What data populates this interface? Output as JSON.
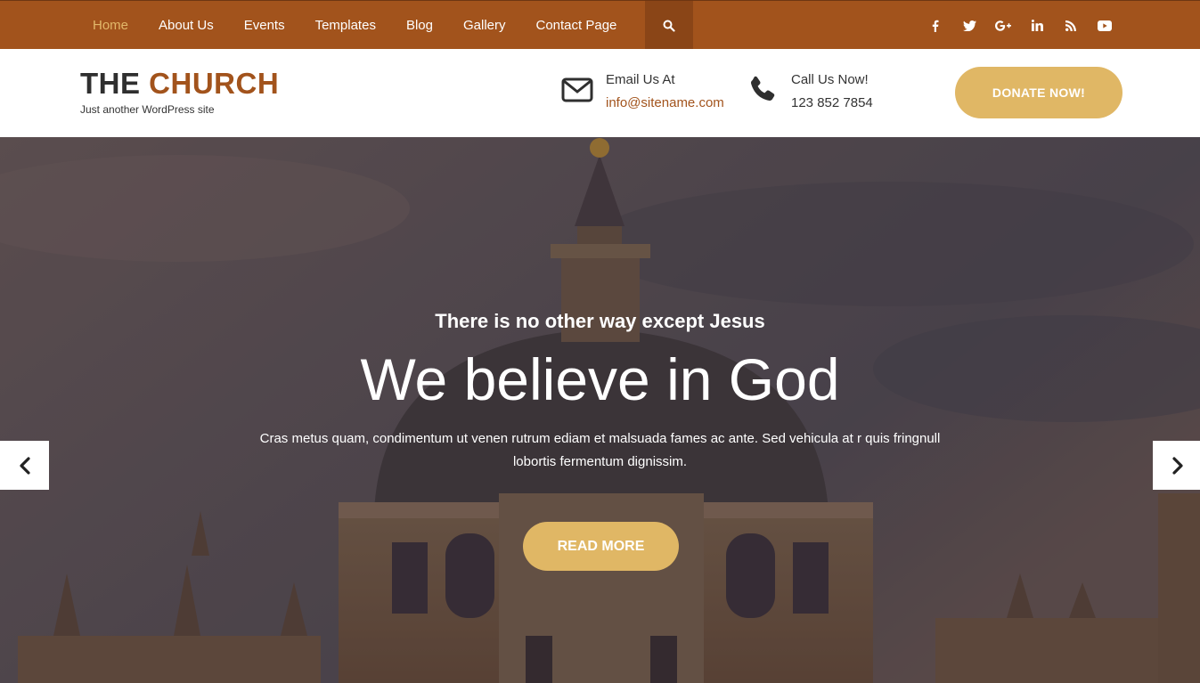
{
  "nav": {
    "items": [
      {
        "label": "Home",
        "active": true
      },
      {
        "label": "About Us"
      },
      {
        "label": "Events"
      },
      {
        "label": "Templates"
      },
      {
        "label": "Blog"
      },
      {
        "label": "Gallery"
      },
      {
        "label": "Contact Page"
      }
    ],
    "search_icon": "search-icon",
    "social": [
      "facebook-icon",
      "twitter-icon",
      "google-plus-icon",
      "linkedin-icon",
      "rss-icon",
      "youtube-icon"
    ]
  },
  "header": {
    "logo_part1": "THE",
    "logo_part2": "CHURCH",
    "tagline": "Just another WordPress site",
    "email_label": "Email Us At",
    "email_value": "info@sitename.com",
    "phone_label": "Call Us Now!",
    "phone_value": "123 852 7854",
    "donate_label": "DONATE NOW!"
  },
  "hero": {
    "subtitle": "There is no other way except Jesus",
    "title": "We believe in God",
    "description": "Cras metus quam, condimentum ut venen rutrum ediam et malsuada fames ac ante. Sed vehicula at r quis fringnull lobortis fermentum dignissim.",
    "button_label": "READ MORE"
  },
  "colors": {
    "topbar": "#a2531c",
    "accent": "#e0b765",
    "active_nav": "#e2b86a"
  }
}
